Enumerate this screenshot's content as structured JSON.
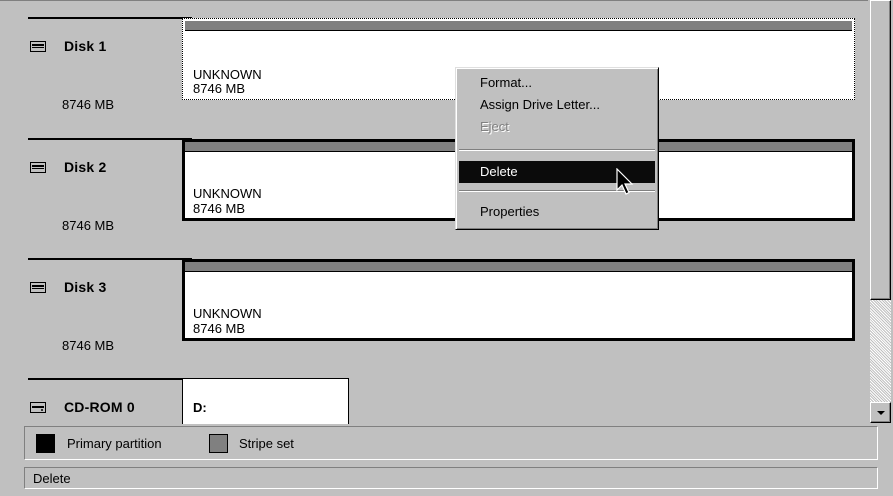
{
  "disks": [
    {
      "name": "Disk 1",
      "size": "8746 MB",
      "partition_type": "UNKNOWN",
      "partition_size": "8746 MB"
    },
    {
      "name": "Disk 2",
      "size": "8746 MB",
      "partition_type": "UNKNOWN",
      "partition_size": "8746 MB"
    },
    {
      "name": "Disk 3",
      "size": "8746 MB",
      "partition_type": "UNKNOWN",
      "partition_size": "8746 MB"
    }
  ],
  "cdrom": {
    "name": "CD-ROM 0",
    "drive": "D:"
  },
  "context_menu": {
    "format": "Format...",
    "assign_drive_letter": "Assign Drive Letter...",
    "eject": "Eject",
    "delete": "Delete",
    "properties": "Properties"
  },
  "legend": {
    "primary_partition": "Primary partition",
    "stripe_set": "Stripe set",
    "primary_color": "#000000",
    "stripe_color": "#808080"
  },
  "status_bar": {
    "text": "Delete"
  },
  "icons": {
    "disk": "hard-disk-icon",
    "cdrom": "cdrom-icon",
    "cursor": "mouse-pointer-icon"
  }
}
